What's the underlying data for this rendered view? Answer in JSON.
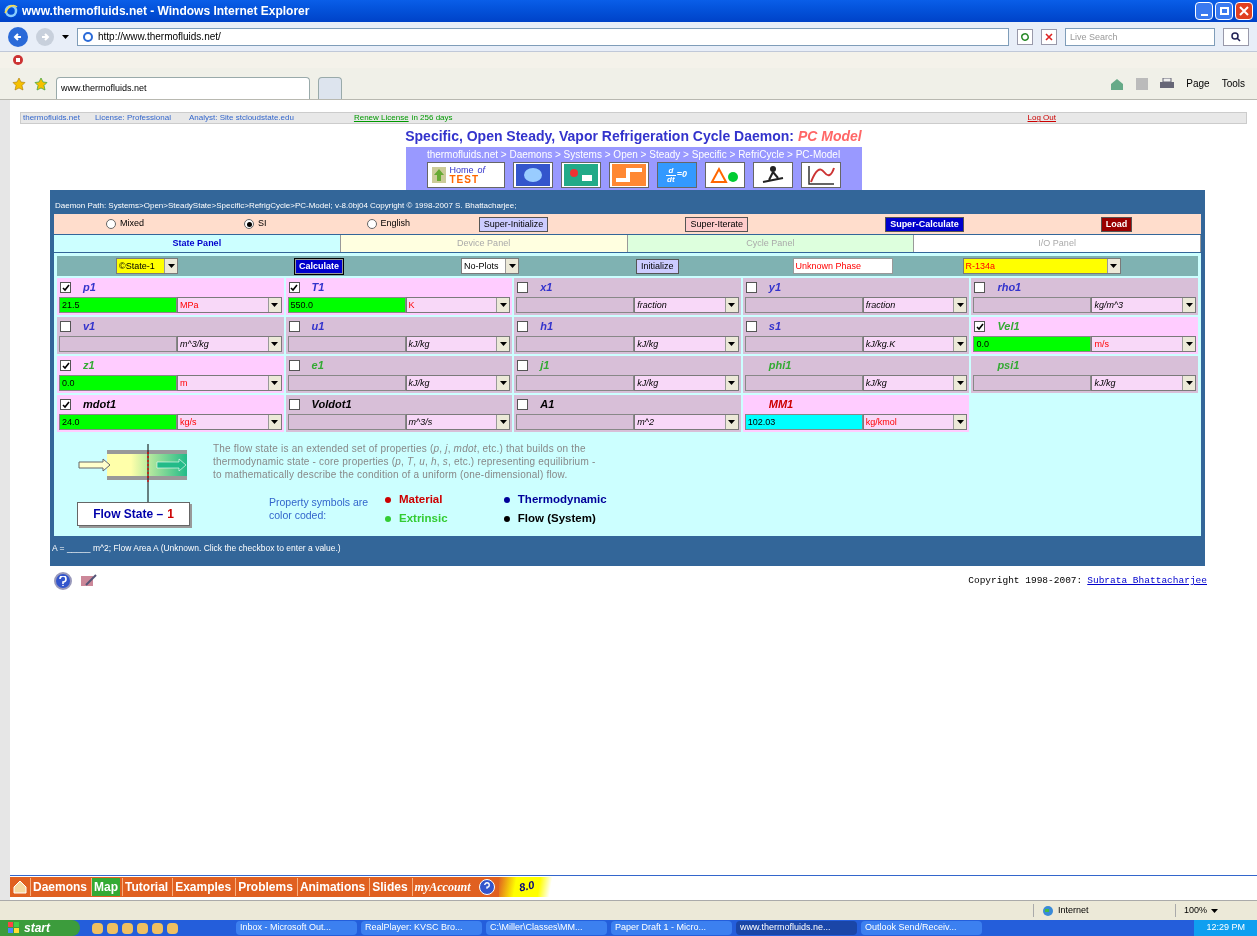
{
  "window": {
    "title": "www.thermofluids.net - Windows Internet Explorer"
  },
  "address_bar": {
    "url": "http://www.thermofluids.net/",
    "search_placeholder": "Live Search"
  },
  "browser_tabs": [
    {
      "label": "www.thermofluids.net",
      "selected": true
    },
    {
      "selected": false
    }
  ],
  "command_bar": [
    "Page",
    "Tools"
  ],
  "info_bar": {
    "site": "thermofluids.net",
    "license": "License: Professional",
    "analyst": "Analyst: Site stcloudstate.edu",
    "renew_link": "Renew License",
    "renew_text": "in 256 days",
    "logout": "Log Out"
  },
  "page_title": {
    "text": "Specific, Open Steady, Vapor Refrigeration Cycle Daemon:",
    "model": "PC Model"
  },
  "breadcrumb": "thermofluids.net > Daemons > Systems > Open > Steady > Specific > RefriCycle > PC-Model",
  "nav_icons": {
    "home_line1": "Home",
    "home_of": "of",
    "home_line2": "TEST",
    "derivative_top": "d",
    "derivative_bottom": "dt",
    "derivative_rest": "=0"
  },
  "daemon_path": "Daemon Path: Systems>Open>SteadyState>Specific>RefrigCycle>PC-Model; v-8.0bj04 Copyright © 1998-2007 S. Bhattacharjee;",
  "units_systems": [
    {
      "label": "Mixed",
      "selected": false
    },
    {
      "label": "SI",
      "selected": true
    },
    {
      "label": "English",
      "selected": false
    }
  ],
  "super_buttons": [
    {
      "label": "Super-Initialize",
      "kind": "initialize"
    },
    {
      "label": "Super-Iterate",
      "kind": "iterate"
    },
    {
      "label": "Super-Calculate",
      "kind": "calculate"
    },
    {
      "label": "Load",
      "kind": "load"
    }
  ],
  "panels": [
    {
      "label": "State Panel",
      "selected": true,
      "color": "#ccffff"
    },
    {
      "label": "Device Panel",
      "selected": false,
      "color": "#ffffe0"
    },
    {
      "label": "Cycle Panel",
      "selected": false,
      "color": "#ddffdd"
    },
    {
      "label": "I/O Panel",
      "selected": false,
      "color": "#ffffff"
    }
  ],
  "controls": {
    "state": "©State-1",
    "calculate": "Calculate",
    "plots": "No-Plots",
    "initialize": "Initialize",
    "phase": "Unknown Phase",
    "fluid": "R-134a"
  },
  "properties": [
    {
      "symbol": "p1",
      "kind": "checkbox",
      "checked": true,
      "color": "#3333cc",
      "value": "21.5",
      "unit": "MPa"
    },
    {
      "symbol": "T1",
      "kind": "checkbox",
      "checked": true,
      "color": "#3333cc",
      "value": "550.0",
      "unit": "K"
    },
    {
      "symbol": "x1",
      "kind": "checkbox",
      "checked": false,
      "color": "#3333cc",
      "unit": "fraction"
    },
    {
      "symbol": "y1",
      "kind": "checkbox",
      "checked": false,
      "color": "#3333cc",
      "unit": "fraction"
    },
    {
      "symbol": "rho1",
      "kind": "checkbox",
      "checked": false,
      "color": "#3333cc",
      "unit": "kg/m^3"
    },
    {
      "symbol": "v1",
      "kind": "checkbox",
      "checked": false,
      "color": "#3333cc",
      "unit": "m^3/kg"
    },
    {
      "symbol": "u1",
      "kind": "checkbox",
      "checked": false,
      "color": "#3333cc",
      "unit": "kJ/kg"
    },
    {
      "symbol": "h1",
      "kind": "checkbox",
      "checked": false,
      "color": "#3333cc",
      "unit": "kJ/kg"
    },
    {
      "symbol": "s1",
      "kind": "checkbox",
      "checked": false,
      "color": "#3333cc",
      "unit": "kJ/kg.K"
    },
    {
      "symbol": "Vel1",
      "kind": "checkbox",
      "checked": true,
      "color": "#33aa33",
      "value": "0.0",
      "unit": "m/s"
    },
    {
      "symbol": "z1",
      "kind": "checkbox",
      "checked": true,
      "color": "#33aa33",
      "value": "0.0",
      "unit": "m"
    },
    {
      "symbol": "e1",
      "kind": "checkbox",
      "checked": false,
      "color": "#33aa33",
      "unit": "kJ/kg"
    },
    {
      "symbol": "j1",
      "kind": "checkbox",
      "checked": false,
      "color": "#33aa33",
      "unit": "kJ/kg"
    },
    {
      "symbol": "phi1",
      "kind": "derived",
      "color": "#33aa33",
      "unit": "kJ/kg"
    },
    {
      "symbol": "psi1",
      "kind": "derived",
      "color": "#33aa33",
      "unit": "kJ/kg"
    },
    {
      "symbol": "mdot1",
      "kind": "checkbox",
      "checked": true,
      "color": "#000000",
      "value": "24.0",
      "unit": "kg/s"
    },
    {
      "symbol": "Voldot1",
      "kind": "checkbox",
      "checked": false,
      "color": "#000000",
      "unit": "m^3/s"
    },
    {
      "symbol": "A1",
      "kind": "checkbox",
      "checked": false,
      "color": "#000000",
      "unit": "m^2"
    },
    {
      "symbol": "MM1",
      "kind": "constant",
      "color": "#cc0000",
      "value": "102.03",
      "unit": "kg/kmol"
    }
  ],
  "description": "The flow state is an extended set of properties (*p*, *j*, *mdot*, etc.)  that builds on the thermodynamic state - core properties (*p*, *T*, *u*, *h*, *s*, etc.) representing equilibrium - to mathematically describe the condition of a uniform (one-dimensional) flow.",
  "flow_state_label": {
    "text": "Flow State –",
    "number": "1"
  },
  "legend": {
    "caption": "Property symbols are color coded:",
    "items": [
      {
        "label": "Material",
        "color": "#cc0000"
      },
      {
        "label": "Thermodynamic",
        "color": "#000099"
      },
      {
        "label": "Extrinsic",
        "color": "#33cc33"
      },
      {
        "label": "Flow (System)",
        "color": "#000000"
      }
    ]
  },
  "message": "A = _____ m^2;  Flow Area A  (Unknown. Click the checkbox to enter a value.)",
  "copyright": {
    "text": "Copyright 1998-2007:",
    "link": "Subrata Bhattacharjee"
  },
  "bottom_nav": [
    {
      "label": "Daemons",
      "selected": false
    },
    {
      "label": "Map",
      "selected": true
    },
    {
      "label": "Tutorial",
      "selected": false
    },
    {
      "label": "Examples",
      "selected": false
    },
    {
      "label": "Problems",
      "selected": false
    },
    {
      "label": "Animations",
      "selected": false
    },
    {
      "label": "Slides",
      "selected": false
    },
    {
      "label": "myAccount",
      "selected": false
    }
  ],
  "version": "8.0",
  "status_bar": {
    "zone": "Internet",
    "zoom": "100%"
  },
  "taskbar": {
    "start": "start",
    "items": [
      {
        "label": "Inbox - Microsoft Out...",
        "selected": false
      },
      {
        "label": "RealPlayer: KVSC Bro...",
        "selected": false
      },
      {
        "label": "C:\\Miller\\Classes\\MM...",
        "selected": false
      },
      {
        "label": "Paper Draft 1 - Micro...",
        "selected": false
      },
      {
        "label": "www.thermofluids.ne...",
        "selected": true
      },
      {
        "label": "Outlook Send/Receiv...",
        "selected": false
      }
    ],
    "clock": "12:29 PM"
  }
}
